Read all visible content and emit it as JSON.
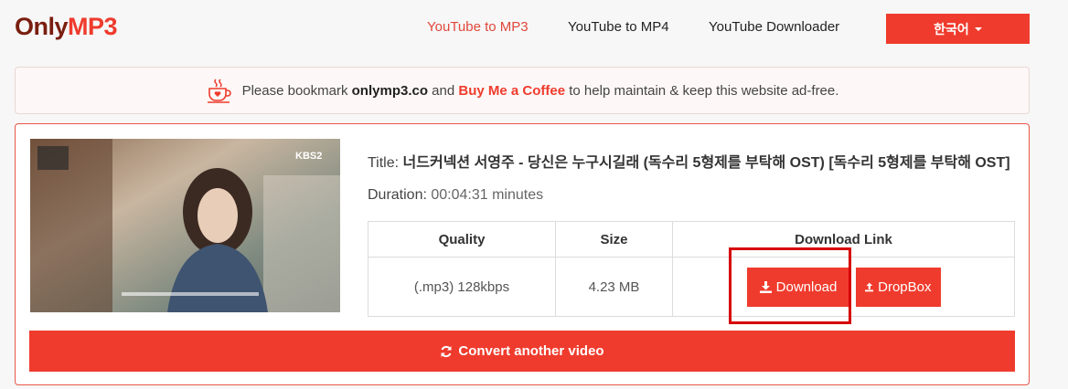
{
  "logo": {
    "part1": "Only",
    "part2": "MP3"
  },
  "nav": {
    "links": [
      {
        "label": "YouTube to MP3",
        "active": true
      },
      {
        "label": "YouTube to MP4",
        "active": false
      },
      {
        "label": "YouTube Downloader",
        "active": false
      }
    ],
    "language": "한국어"
  },
  "notice": {
    "prefix": "Please bookmark ",
    "site": "onlymp3.co",
    "middle": " and ",
    "coffee": "Buy Me a Coffee",
    "suffix": " to help maintain & keep this website ad-free."
  },
  "video": {
    "title_label": "Title: ",
    "title_value": "너드커넥션 서영주 - 당신은 누구시길래 (독수리 5형제를 부탁해 OST) [독수리 5형제를 부탁해 OST]",
    "duration_label": "Duration: ",
    "duration_value": "00:04:31 minutes",
    "thumb_badge": "KBS2"
  },
  "table": {
    "headers": [
      "Quality",
      "Size",
      "Download Link"
    ],
    "row": {
      "quality": "(.mp3) 128kbps",
      "size": "4.23 MB"
    }
  },
  "buttons": {
    "download": "Download",
    "dropbox": "DropBox",
    "convert": "Convert another video"
  },
  "colors": {
    "accent": "#ef3b2d",
    "logo_dark": "#7a1e10",
    "highlight": "#d60000"
  }
}
